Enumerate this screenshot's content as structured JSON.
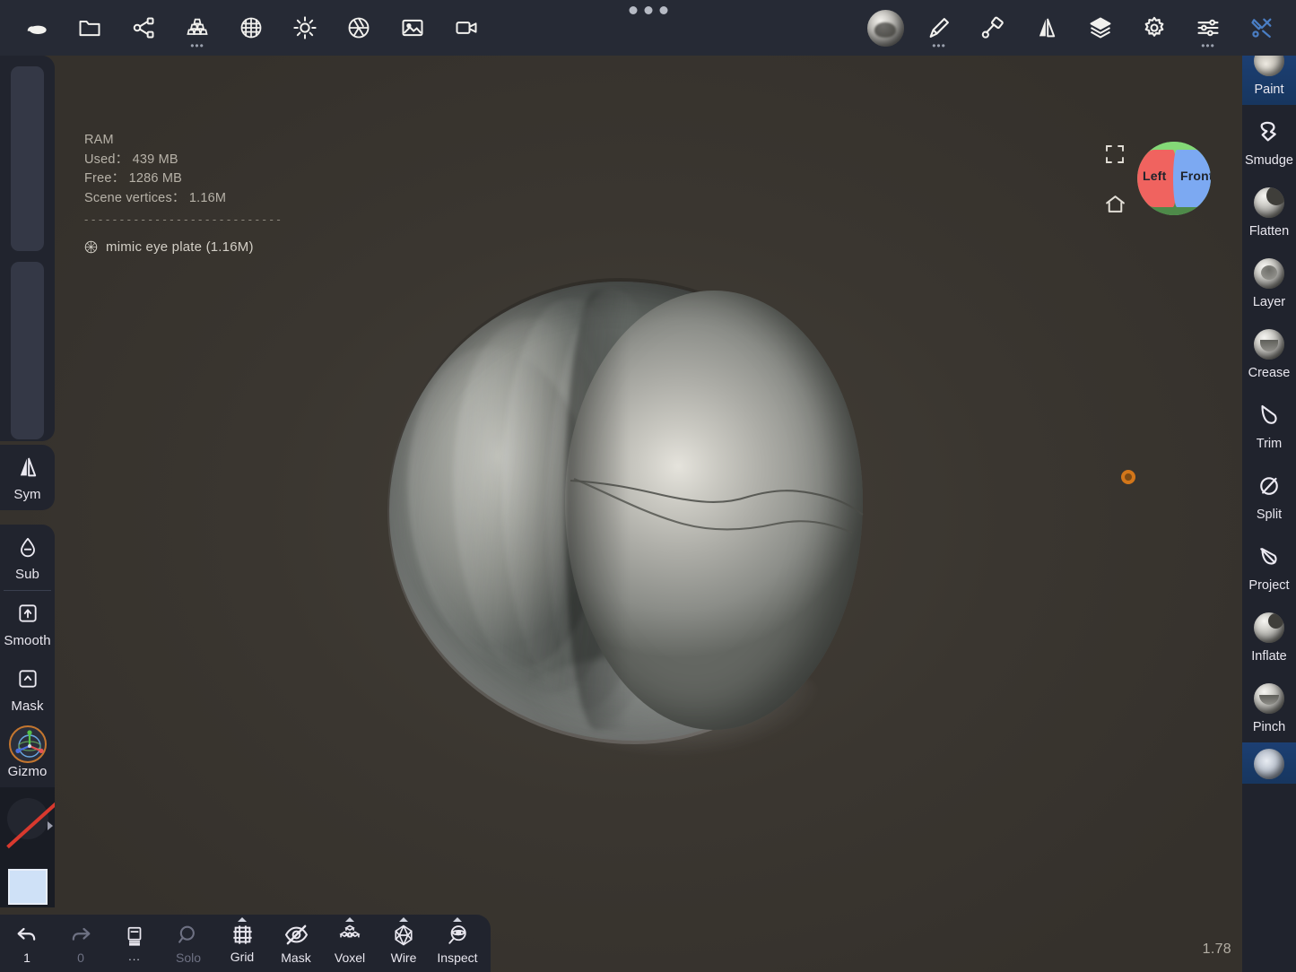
{
  "app": {
    "title": "Nomad Sculpt",
    "background_color": "#3a3630",
    "chrome_color": "#21242e",
    "accent_color": "#2f6ab5"
  },
  "topbar": {
    "grip": "drag-handle-dots",
    "left_tools": [
      {
        "name": "scene-icon",
        "label": "Scene",
        "dots": false
      },
      {
        "name": "folder-icon",
        "label": "Files",
        "dots": false
      },
      {
        "name": "topology-icon",
        "label": "Topology",
        "dots": false
      },
      {
        "name": "stack-icon",
        "label": "Multires",
        "dots": true
      },
      {
        "name": "sphere-grid-icon",
        "label": "Voxel Remesh",
        "dots": false
      },
      {
        "name": "light-icon",
        "label": "Lighting",
        "dots": false
      },
      {
        "name": "aperture-icon",
        "label": "Post Process",
        "dots": false
      },
      {
        "name": "image-icon",
        "label": "Background",
        "dots": false
      },
      {
        "name": "camera-icon",
        "label": "Camera",
        "dots": false
      }
    ],
    "right_tools": [
      {
        "name": "material-ball-icon",
        "label": "Material",
        "dots": false,
        "active": false
      },
      {
        "name": "brush-icon",
        "label": "Brush",
        "dots": true,
        "active": false
      },
      {
        "name": "paint-bucket-icon",
        "label": "Fill",
        "dots": false,
        "active": false
      },
      {
        "name": "mirror-icon",
        "label": "Symmetry",
        "dots": false,
        "active": false
      },
      {
        "name": "layers-icon",
        "label": "Layers",
        "dots": false,
        "active": false
      },
      {
        "name": "gear-icon",
        "label": "Settings",
        "dots": false,
        "active": false
      },
      {
        "name": "sliders-icon",
        "label": "Adjust",
        "dots": true,
        "active": false
      },
      {
        "name": "tools-icon",
        "label": "Tools",
        "dots": false,
        "active": true
      }
    ]
  },
  "hud": {
    "ram_label": "RAM",
    "used_label": "Used：",
    "used_value": "439 MB",
    "free_label": "Free：",
    "free_value": "1286 MB",
    "vertices_label": "Scene vertices：",
    "vertices_value": "1.16M",
    "separator": "- - - - - - - - - - - - - - - - - - - - - - - - - - - -",
    "object_name": "mimic eye plate (1.16M)"
  },
  "navigation": {
    "fullscreen_icon": "fullscreen-icon",
    "home_icon": "home-icon",
    "cube": {
      "left_label": "Left",
      "front_label": "Front",
      "left_color": "#f0635f",
      "front_color": "#7ca9f2",
      "top_color": "#84d977",
      "bottom_color": "#4e8a49"
    }
  },
  "left_sidebar": {
    "sliders": [
      {
        "name": "brush-radius-slider",
        "value": 100
      },
      {
        "name": "brush-intensity-slider",
        "value": 100
      }
    ],
    "tools": [
      {
        "name": "sym",
        "label": "Sym",
        "icon": "mirror-icon"
      },
      {
        "name": "sub",
        "label": "Sub",
        "icon": "droplet-minus-icon"
      },
      {
        "name": "smooth",
        "label": "Smooth",
        "icon": "square-arrow-up-icon"
      },
      {
        "name": "mask",
        "label": "Mask",
        "icon": "square-caret-up-icon"
      },
      {
        "name": "gizmo",
        "label": "Gizmo",
        "icon": "gizmo-axes-icon"
      }
    ],
    "stroke_preview": {
      "name": "alpha-preview",
      "disabled": true
    },
    "color_swatch": {
      "name": "color-swatch",
      "color": "#cfe1f7"
    }
  },
  "right_sidebar": {
    "brushes": [
      {
        "name": "paint",
        "label": "Paint",
        "icon": "sphere-paint-icon",
        "selected": true,
        "clipped": "top"
      },
      {
        "name": "smudge",
        "label": "Smudge",
        "icon": "smudge-icon",
        "selected": false
      },
      {
        "name": "flatten",
        "label": "Flatten",
        "icon": "sphere-flatten-icon",
        "selected": false
      },
      {
        "name": "layer",
        "label": "Layer",
        "icon": "sphere-layer-icon",
        "selected": false
      },
      {
        "name": "crease",
        "label": "Crease",
        "icon": "sphere-crease-icon",
        "selected": false
      },
      {
        "name": "trim",
        "label": "Trim",
        "icon": "trim-icon",
        "selected": false
      },
      {
        "name": "split",
        "label": "Split",
        "icon": "split-icon",
        "selected": false
      },
      {
        "name": "project",
        "label": "Project",
        "icon": "project-icon",
        "selected": false
      },
      {
        "name": "inflate",
        "label": "Inflate",
        "icon": "sphere-inflate-icon",
        "selected": false
      },
      {
        "name": "pinch",
        "label": "Pinch",
        "icon": "sphere-pinch-icon",
        "selected": false
      },
      {
        "name": "next",
        "label": "",
        "icon": "sphere-icon",
        "selected": true,
        "clipped": "bottom"
      }
    ]
  },
  "bottombar": {
    "items": [
      {
        "name": "undo-button",
        "label": "1",
        "icon": "undo-icon",
        "dim": false,
        "caret": false
      },
      {
        "name": "redo-button",
        "label": "0",
        "icon": "redo-icon",
        "dim": true,
        "caret": false
      },
      {
        "name": "layers-button",
        "label": "...",
        "icon": "pages-icon",
        "dim": false,
        "caret": false
      },
      {
        "name": "solo-button",
        "label": "Solo",
        "icon": "magnifier-icon",
        "dim": true,
        "caret": false
      },
      {
        "name": "grid-button",
        "label": "Grid",
        "icon": "grid-icon",
        "dim": false,
        "caret": true
      },
      {
        "name": "mask-button",
        "label": "Mask",
        "icon": "eye-off-icon",
        "dim": false,
        "caret": false
      },
      {
        "name": "voxel-button",
        "label": "Voxel",
        "icon": "voxel-icon",
        "dim": false,
        "caret": true
      },
      {
        "name": "wire-button",
        "label": "Wire",
        "icon": "wire-icon",
        "dim": false,
        "caret": true
      },
      {
        "name": "inspect-button",
        "label": "Inspect",
        "icon": "inspect-icon",
        "dim": false,
        "caret": true
      }
    ]
  },
  "statusbar": {
    "zoom_value": "1.78"
  }
}
